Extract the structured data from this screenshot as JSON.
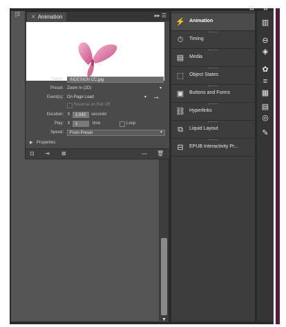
{
  "doc_tab_label": "[3",
  "animation_panel": {
    "tab_label": "Animation",
    "menu_icons": [
      "forward-icon",
      "menu-icon"
    ],
    "name_label": "Name:",
    "name_value": "INDESIGN CC.jpg",
    "preset_label": "Preset:",
    "preset_value": "Zoom In (2D)",
    "events_label": "Event(s):",
    "events_value": "On Page Load",
    "reverse_label": "Reverse on Roll Off",
    "duration_label": "Duration:",
    "duration_value": "1.042",
    "duration_unit": "seconds",
    "play_label": "Play:",
    "play_value": "1",
    "play_unit": "time",
    "loop_label": "Loop",
    "speed_label": "Speed:",
    "speed_value": "From Preset",
    "properties_label": "Properties"
  },
  "side_panel": {
    "items": [
      {
        "label": "Animation",
        "icon": "animation-icon",
        "selected": true
      },
      {
        "label": "Timing",
        "icon": "timing-icon"
      },
      {
        "label": "Media",
        "icon": "media-icon"
      },
      {
        "label": "Object States",
        "icon": "object-states-icon"
      },
      {
        "label": "Buttons and Forms",
        "icon": "buttons-forms-icon"
      },
      {
        "label": "Hyperlinks",
        "icon": "hyperlinks-icon"
      },
      {
        "label": "Liquid Layout",
        "icon": "liquid-layout-icon"
      },
      {
        "label": "EPUB Interactivity Pr...",
        "icon": "epub-icon"
      }
    ]
  },
  "right_column_icons": [
    "pages-icon",
    "links-icon",
    "layers-icon",
    "swatches-icon",
    "stroke-icon",
    "color-icon",
    "gradient-icon",
    "effects-icon",
    "styles-icon"
  ],
  "colors": {
    "accent_frame": "#5a1a40",
    "butterfly": "#d05a8c"
  }
}
